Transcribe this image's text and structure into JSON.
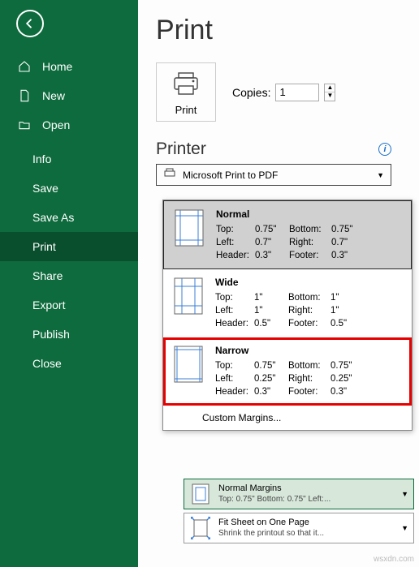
{
  "sidebar": {
    "items": [
      {
        "label": "Home"
      },
      {
        "label": "New"
      },
      {
        "label": "Open"
      },
      {
        "label": "Info"
      },
      {
        "label": "Save"
      },
      {
        "label": "Save As"
      },
      {
        "label": "Print"
      },
      {
        "label": "Share"
      },
      {
        "label": "Export"
      },
      {
        "label": "Publish"
      },
      {
        "label": "Close"
      }
    ]
  },
  "main": {
    "title": "Print",
    "print_button_label": "Print",
    "copies_label": "Copies:",
    "copies_value": "1",
    "printer_heading": "Printer",
    "printer_selected": "Microsoft Print to PDF"
  },
  "margins_popup": {
    "options": [
      {
        "name": "Normal",
        "top": "0.75\"",
        "bottom": "0.75\"",
        "left": "0.7\"",
        "right": "0.7\"",
        "header": "0.3\"",
        "footer": "0.3\""
      },
      {
        "name": "Wide",
        "top": "1\"",
        "bottom": "1\"",
        "left": "1\"",
        "right": "1\"",
        "header": "0.5\"",
        "footer": "0.5\""
      },
      {
        "name": "Narrow",
        "top": "0.75\"",
        "bottom": "0.75\"",
        "left": "0.25\"",
        "right": "0.25\"",
        "header": "0.3\"",
        "footer": "0.3\""
      }
    ],
    "labels": {
      "top": "Top:",
      "bottom": "Bottom:",
      "left": "Left:",
      "right": "Right:",
      "header": "Header:",
      "footer": "Footer:"
    },
    "custom_label": "Custom Margins..."
  },
  "dropdowns": {
    "margins": {
      "line1": "Normal Margins",
      "line2": "Top: 0.75\" Bottom: 0.75\" Left:..."
    },
    "scaling": {
      "line1": "Fit Sheet on One Page",
      "line2": "Shrink the printout so that it..."
    }
  },
  "watermark": "wsxdn.com"
}
